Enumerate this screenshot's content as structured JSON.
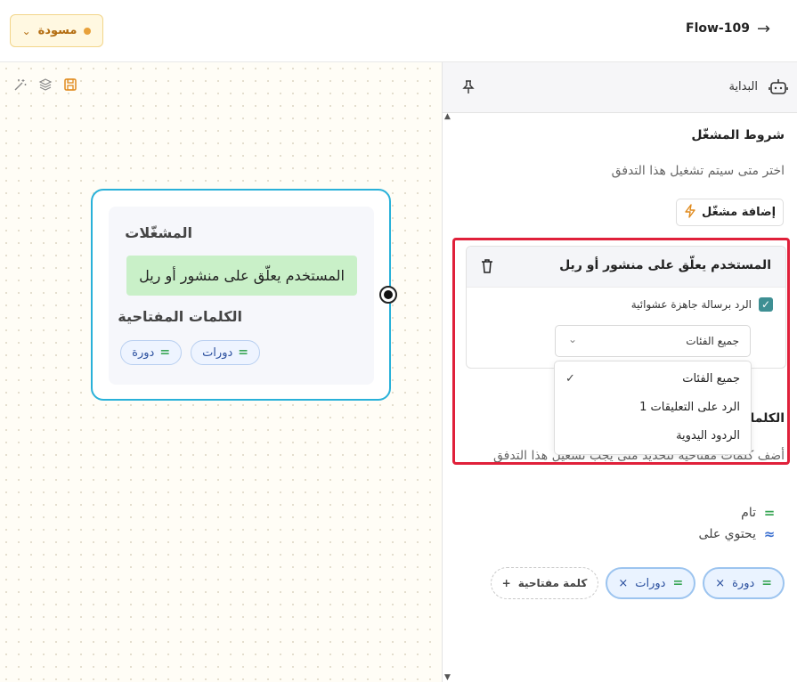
{
  "header": {
    "flow_name": "Flow-109",
    "status_label": "مسودة",
    "status_color": "#e8a13a",
    "back_icon": "arrow-right-icon"
  },
  "canvas": {
    "tools": [
      "magic-wand-icon",
      "layers-icon",
      "save-icon"
    ],
    "node": {
      "triggers_heading": "المشغّلات",
      "trigger_text": "المستخدم يعلّق على منشور أو ريل",
      "keywords_heading": "الكلمات المفتاحية",
      "keywords": [
        "دورة",
        "دورات"
      ]
    }
  },
  "panel": {
    "title": "البداية",
    "trigger_section": {
      "title": "شروط المشغّل",
      "description": "اختر متى سيتم تشغيل هذا التدفق",
      "add_button": "إضافة مشغّل"
    },
    "trigger_card": {
      "title": "المستخدم يعلّق على منشور أو ريل",
      "checkbox_label": "الرد برسالة جاهزة عشوائية",
      "checkbox_checked": true,
      "select_value": "جميع الفئات",
      "dropdown_options": [
        "جميع الفئات",
        "الرد على التعليقات 1",
        "الردود اليدوية"
      ],
      "selected_option": "جميع الفئات"
    },
    "keywords_section": {
      "title": "الكلمات",
      "description": "أضف كلمات مفتاحية لتحديد متى يجب تشغيل هذا التدفق",
      "match_exact": "تام",
      "match_contains": "يحتوي على",
      "chips": [
        "دورة",
        "دورات"
      ],
      "add_keyword": "كلمة مفتاحية"
    }
  },
  "colors": {
    "accent_border": "#29b1d9",
    "trigger_bg": "#c9f0c8",
    "highlight": "#e0203a"
  }
}
